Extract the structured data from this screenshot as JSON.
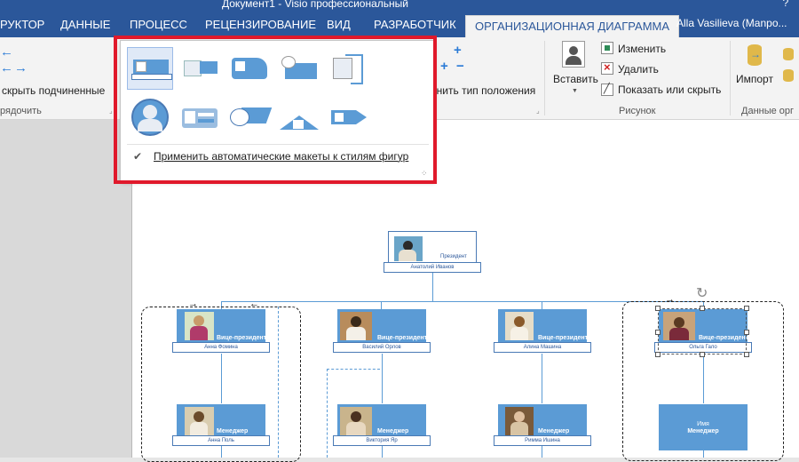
{
  "window": {
    "title": "Документ1 - Visio профессиональный",
    "help": "?"
  },
  "tabs": [
    {
      "label": "РУКТОР"
    },
    {
      "label": "ДАННЫЕ"
    },
    {
      "label": "ПРОЦЕСС"
    },
    {
      "label": "РЕЦЕНЗИРОВАНИЕ"
    },
    {
      "label": "ВИД"
    },
    {
      "label": "РАЗРАБОТЧИК"
    },
    {
      "label": "ОРГАНИЗАЦИОННАЯ ДИАГРАММА",
      "active": true
    }
  ],
  "user": "Alla Vasilieva (Manpo...",
  "ribbon": {
    "left_button": "скрыть подчиненные",
    "left_group": "рядочить",
    "position_type": "енить тип положения",
    "insert": "Вставить",
    "change": "Изменить",
    "delete": "Удалить",
    "show_hide": "Показать или скрыть",
    "picture_group": "Рисунок",
    "import": "Импорт",
    "data_group": "Данные орг"
  },
  "gallery": {
    "apply_label": "Применить автоматические макеты к стилям фигур",
    "layouts": [
      {
        "name": "layout-1",
        "selected": true
      },
      {
        "name": "layout-2"
      },
      {
        "name": "layout-3"
      },
      {
        "name": "layout-4"
      },
      {
        "name": "layout-5"
      },
      {
        "name": "layout-6"
      },
      {
        "name": "layout-7"
      },
      {
        "name": "layout-8"
      },
      {
        "name": "layout-9"
      },
      {
        "name": "layout-10"
      }
    ]
  },
  "org": {
    "president": {
      "title": "Президент",
      "name": "Анатолий Иванов"
    },
    "vps": [
      {
        "title": "Вице-президент",
        "name": "Анна Фомина"
      },
      {
        "title": "Вице-президент",
        "name": "Василий Орлов"
      },
      {
        "title": "Вице-президент",
        "name": "Алина Машина"
      },
      {
        "title": "Вице-президент",
        "name": "Ольга Гало"
      }
    ],
    "managers": [
      {
        "title": "Менеджер",
        "name": "Анна Поль"
      },
      {
        "title": "Менеджер",
        "name": "Виктория Яр"
      },
      {
        "title": "Менеджер",
        "name": "Римма Ишина"
      },
      {
        "title": "Менеджер",
        "name": "Имя"
      }
    ]
  },
  "colors": {
    "ribbon_blue": "#2b579a",
    "shape_blue": "#5b9bd5",
    "highlight_red": "#e0192b"
  }
}
